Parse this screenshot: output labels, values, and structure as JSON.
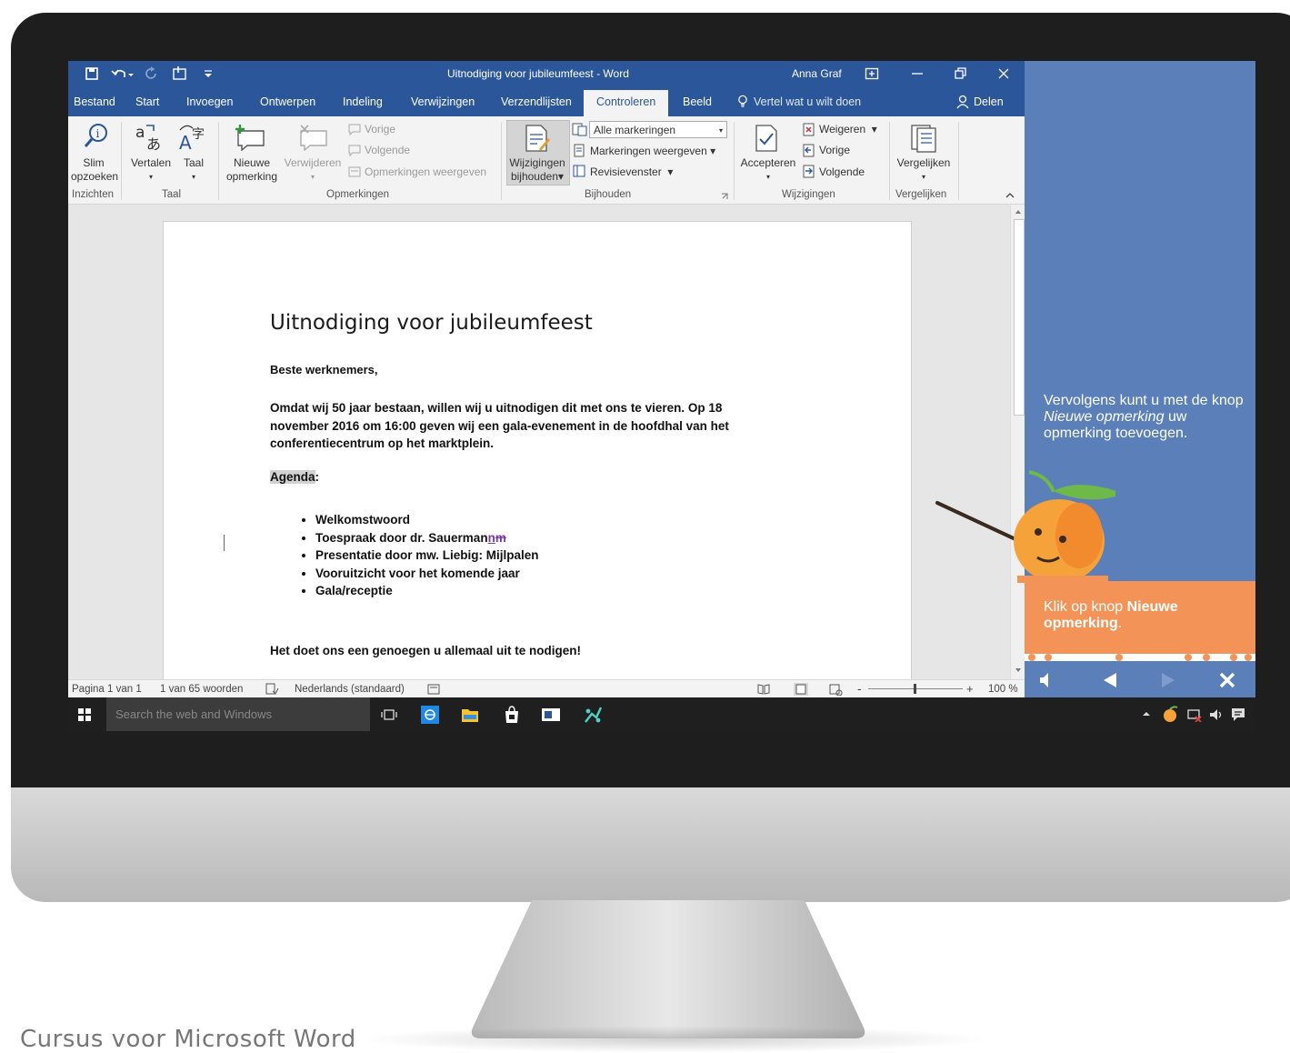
{
  "window": {
    "title": "Uitnodiging voor jubileumfeest - Word",
    "user": "Anna Graf"
  },
  "tabs": [
    "Bestand",
    "Start",
    "Invoegen",
    "Ontwerpen",
    "Indeling",
    "Verwijzingen",
    "Verzendlijsten",
    "Controleren",
    "Beeld"
  ],
  "active_tab": "Controleren",
  "tell_me": "Vertel wat u wilt doen",
  "share": "Delen",
  "ribbon": {
    "slim": [
      "Slim",
      "opzoeken"
    ],
    "vertalen": "Vertalen",
    "taal": "Taal",
    "nieuwe": [
      "Nieuwe",
      "opmerking"
    ],
    "verwijderen": "Verwijderen",
    "vorige": "Vorige",
    "volgende": "Volgende",
    "opm_weergeven": "Opmerkingen weergeven",
    "wijz": [
      "Wijzigingen",
      "bijhouden"
    ],
    "alle_mark": "Alle markeringen",
    "mark_weergeven": "Markeringen weergeven",
    "revisie": "Revisievenster",
    "accepteren": "Accepteren",
    "weigeren": "Weigeren",
    "w_vorige": "Vorige",
    "w_volgende": "Volgende",
    "vergelijken": "Vergelijken",
    "groups": {
      "inzichten": "Inzichten",
      "taal": "Taal",
      "opmerkingen": "Opmerkingen",
      "bijhouden": "Bijhouden",
      "wijzigingen": "Wijzigingen",
      "vergelijken": "Vergelijken"
    }
  },
  "document": {
    "title": "Uitnodiging voor jubileumfeest",
    "greeting": "Beste werknemers,",
    "para_lines": [
      "Omdat wij 50 jaar bestaan, willen wij u uitnodigen dit met ons te vieren. Op 18",
      "november 2016 om 16:00 geven wij een gala-evenement in de hoofdhal van het",
      "conferentiecentrum op het marktplein."
    ],
    "agenda_word": "Agenda",
    "agenda_colon": ":",
    "bullets": [
      "Welkomstwoord",
      "Toespraak door dr. Sauerman",
      "Presentatie door mw. Liebig: Mijlpalen",
      "Vooruitzicht voor het komende jaar",
      "Gala/receptie"
    ],
    "bullet2_ins": "n",
    "bullet2_del": "m",
    "closing": "Het doet ons een genoegen u allemaal uit te nodigen!"
  },
  "status": {
    "page": "Pagina 1 van 1",
    "words": "1 van 65 woorden",
    "language": "Nederlands (standaard)",
    "zoom": "100 %"
  },
  "taskbar": {
    "search_placeholder": "Search the web and Windows"
  },
  "tutorial": {
    "text1_pre": "Vervolgens kunt u met de knop ",
    "text1_em": "Nieuwe opmerking",
    "text1_post": " uw opmerking toevoegen.",
    "text2_pre": "Klik op knop ",
    "text2_bold": "Nieuwe opmerking",
    "text2_post": "."
  },
  "caption": "Cursus voor Microsoft Word",
  "colors": {
    "word_blue": "#2b579a",
    "panel_blue": "#5b7fb9",
    "panel_orange": "#f39357",
    "taskbar": "#1f1f1f"
  }
}
